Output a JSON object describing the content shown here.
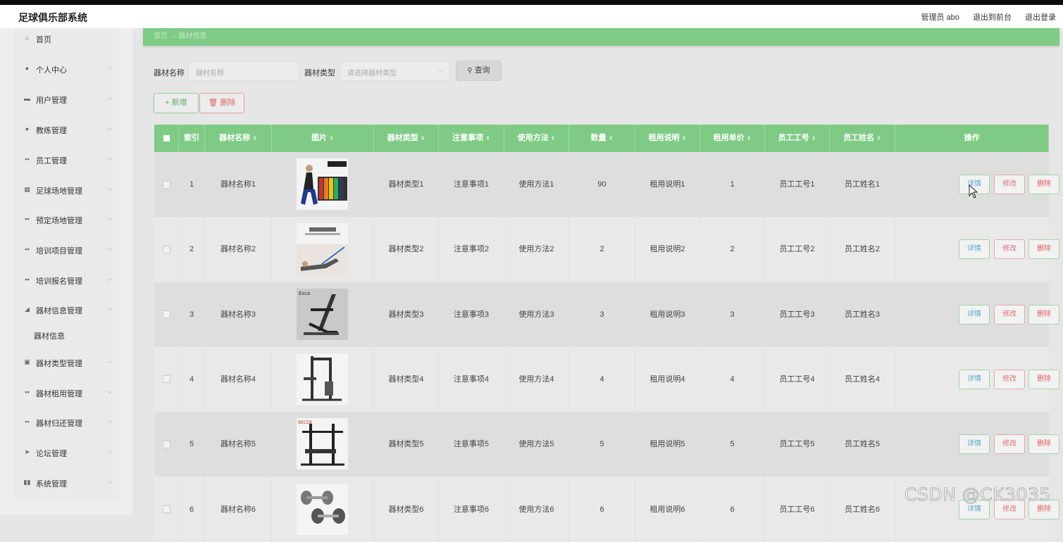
{
  "app": {
    "title": "足球俱乐部系统",
    "user_label": "管理员 abo",
    "to_frontend": "退出到前台",
    "logout": "退出登录"
  },
  "sidebar": {
    "items": [
      {
        "label": "首页",
        "icon": "home-icon",
        "glyph": "⌂",
        "arrow": false
      },
      {
        "label": "个人中心",
        "icon": "user-icon",
        "glyph": "●",
        "arrow": true
      },
      {
        "label": "用户管理",
        "icon": "users-icon",
        "glyph": "▬",
        "arrow": true
      },
      {
        "label": "教练管理",
        "icon": "coach-icon",
        "glyph": "●",
        "arrow": true
      },
      {
        "label": "员工管理",
        "icon": "grid-icon",
        "glyph": "▪▪",
        "arrow": true
      },
      {
        "label": "足球场地管理",
        "icon": "field-icon",
        "glyph": "▦",
        "arrow": true
      },
      {
        "label": "预定场地管理",
        "icon": "grid-icon",
        "glyph": "▪▪",
        "arrow": true
      },
      {
        "label": "培训项目管理",
        "icon": "grid-icon",
        "glyph": "▪▪",
        "arrow": true
      },
      {
        "label": "培训报名管理",
        "icon": "grid-icon",
        "glyph": "▪▪",
        "arrow": true
      },
      {
        "label": "器材信息管理",
        "icon": "equipment-icon",
        "glyph": "◢",
        "arrow": true
      },
      {
        "label": "器材类型管理",
        "icon": "box-icon",
        "glyph": "▣",
        "arrow": true
      },
      {
        "label": "器材租用管理",
        "icon": "grid-icon",
        "glyph": "▪▪",
        "arrow": true
      },
      {
        "label": "器材归还管理",
        "icon": "grid-icon",
        "glyph": "▪▪",
        "arrow": true
      },
      {
        "label": "论坛管理",
        "icon": "send-icon",
        "glyph": "➤",
        "arrow": true
      },
      {
        "label": "系统管理",
        "icon": "chart-icon",
        "glyph": "▮▮",
        "arrow": true
      }
    ],
    "submenu_label": "器材信息"
  },
  "breadcrumb": {
    "text": "首页 → 器材信息"
  },
  "search": {
    "name_label": "器材名称",
    "name_placeholder": "器材名称",
    "type_label": "器材类型",
    "type_placeholder": "请选择器材类型",
    "query_label": "查询"
  },
  "actions": {
    "add_label": "新增",
    "delete_label": "删除"
  },
  "table": {
    "headers": [
      "索引",
      "器材名称",
      "图片",
      "器材类型",
      "注意事项",
      "使用方法",
      "数量",
      "租用说明",
      "租用单价",
      "员工工号",
      "员工姓名",
      "操作"
    ],
    "rows": [
      {
        "index": "1",
        "name": "器材名称1",
        "type": "器材类型1",
        "notes": "注意事项1",
        "usage": "使用方法1",
        "quantity": "90",
        "rent_desc": "租用说明1",
        "price": "1",
        "emp_no": "员工工号1",
        "emp_name": "员工姓名1",
        "image": "resistance-bands-image"
      },
      {
        "index": "2",
        "name": "器材名称2",
        "type": "器材类型2",
        "notes": "注意事项2",
        "usage": "使用方法2",
        "quantity": "2",
        "rent_desc": "租用说明2",
        "price": "2",
        "emp_no": "员工工号2",
        "emp_name": "员工姓名2",
        "image": "stretch-band-image"
      },
      {
        "index": "3",
        "name": "器材名称3",
        "type": "器材类型3",
        "notes": "注意事项3",
        "usage": "使用方法3",
        "quantity": "3",
        "rent_desc": "租用说明3",
        "price": "3",
        "emp_no": "员工工号3",
        "emp_name": "员工姓名3",
        "image": "ab-machine-image"
      },
      {
        "index": "4",
        "name": "器材名称4",
        "type": "器材类型4",
        "notes": "注意事项4",
        "usage": "使用方法4",
        "quantity": "4",
        "rent_desc": "租用说明4",
        "price": "4",
        "emp_no": "员工工号4",
        "emp_name": "员工姓名4",
        "image": "home-gym-image"
      },
      {
        "index": "5",
        "name": "器材名称5",
        "type": "器材类型5",
        "notes": "注意事项5",
        "usage": "使用方法5",
        "quantity": "5",
        "rent_desc": "租用说明5",
        "price": "5",
        "emp_no": "员工工号5",
        "emp_name": "员工姓名5",
        "image": "squat-rack-image"
      },
      {
        "index": "6",
        "name": "器材名称6",
        "type": "器材类型6",
        "notes": "注意事项6",
        "usage": "使用方法6",
        "quantity": "6",
        "rent_desc": "租用说明6",
        "price": "6",
        "emp_no": "员工工号6",
        "emp_name": "员工姓名6",
        "image": "dumbbells-image"
      }
    ],
    "row_buttons": {
      "detail": "详情",
      "edit": "修改",
      "delete": "删除"
    }
  },
  "watermark": "CSDN @CK3035",
  "colors": {
    "accent": "#7fcb85",
    "page_bg": "#e6e6e6",
    "danger": "#e06666",
    "info": "#5aa8c8"
  }
}
